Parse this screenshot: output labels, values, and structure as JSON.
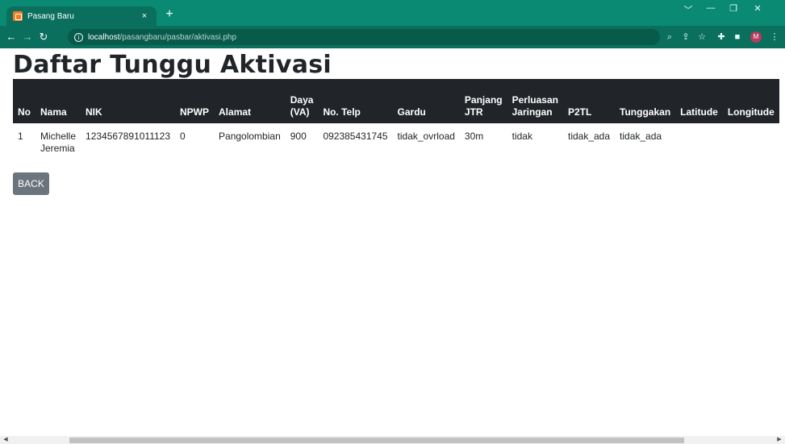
{
  "browser": {
    "tab_title": "Pasang Baru",
    "tab_close": "×",
    "new_tab": "+",
    "url_host": "localhost",
    "url_path": "/pasangbaru/pasbar/aktivasi.php",
    "profile_initial": "M",
    "window_controls": [
      "﹀",
      "—",
      "❐",
      "✕"
    ]
  },
  "page": {
    "title": "Daftar Tunggu Aktivasi",
    "back_label": "BACK"
  },
  "table": {
    "headers": {
      "no": "No",
      "nama": "Nama",
      "nik": "NIK",
      "npwp": "NPWP",
      "alamat": "Alamat",
      "daya_1": "Daya",
      "daya_2": "(VA)",
      "telp": "No. Telp",
      "gardu": "Gardu",
      "panjang_1": "Panjang",
      "panjang_2": "JTR",
      "perluasan_1": "Perluasan",
      "perluasan_2": "Jaringan",
      "p2tl": "P2TL",
      "tunggakan": "Tunggakan",
      "latitude": "Latitude",
      "longitude": "Longitude"
    },
    "rows": [
      {
        "no": "1",
        "nama_1": "Michelle",
        "nama_2": "Jeremia",
        "nik": "1234567891011123",
        "npwp": "0",
        "alamat": "Pangolombian",
        "daya": "900",
        "telp": "092385431745",
        "gardu": "tidak_ovrload",
        "panjang": "30m",
        "perluasan": "tidak",
        "p2tl": "tidak_ada",
        "tunggakan": "tidak_ada",
        "latitude": "",
        "longitude": ""
      }
    ]
  },
  "colors": {
    "tab_bar": "#0b8a73",
    "toolbar": "#0a6f5d",
    "table_header": "#212529",
    "back_button": "#6c757d"
  }
}
